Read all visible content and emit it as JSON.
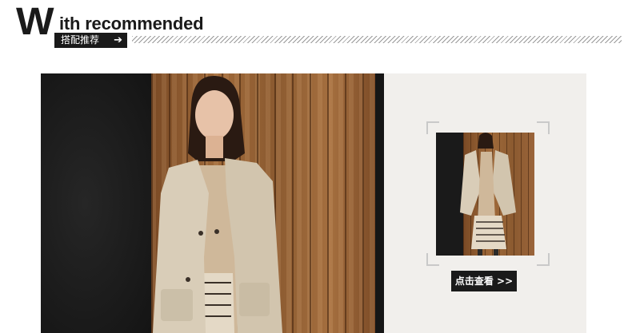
{
  "header": {
    "title_initial": "W",
    "title_rest": "ith recommended",
    "subtitle": "搭配推荐",
    "subtitle_arrow": "➔"
  },
  "main_image": {
    "icon": "model-photo"
  },
  "thumbnail": {
    "icon": "model-thumbnail"
  },
  "view_button": {
    "label": "点击查看 >>"
  },
  "colors": {
    "text_dark": "#1a1a1a",
    "panel_bg": "#f1efec",
    "wood": "#a06a3a",
    "coat": "#d8ccb8"
  }
}
